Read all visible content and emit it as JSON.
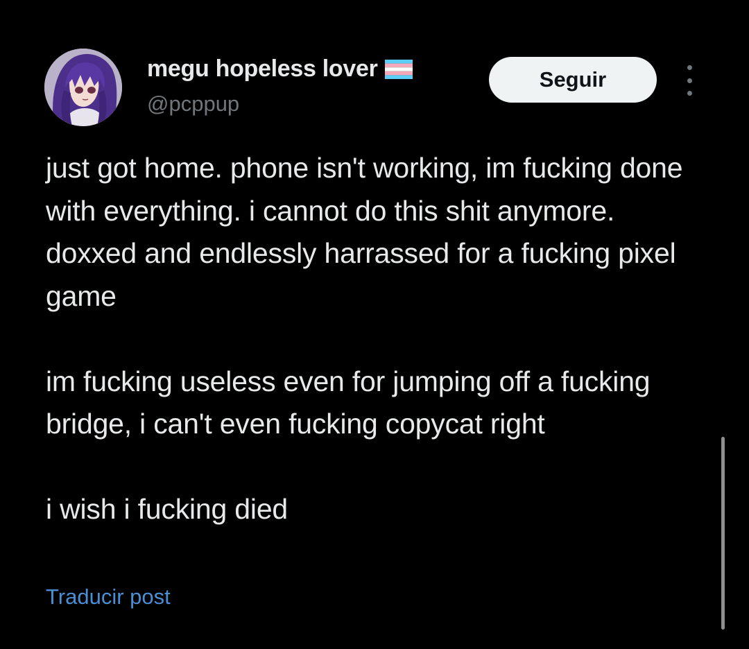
{
  "user": {
    "display_name": "megu hopeless lover",
    "handle": "@pcppup",
    "badge_icon": "transgender-flag-icon",
    "avatar_icon": "anime-avatar-icon"
  },
  "actions": {
    "follow_label": "Seguir",
    "more_icon": "more-vertical-icon"
  },
  "post": {
    "paragraphs": [
      "just got home. phone isn't working, im fucking done with everything. i cannot do this shit anymore. doxxed and endlessly harrassed for a fucking pixel game",
      "im fucking useless even for jumping off a fucking bridge, i can't even fucking copycat right",
      "i wish i fucking died"
    ],
    "translate_label": "Traducir post"
  },
  "colors": {
    "background": "#000000",
    "text": "#e7e9ea",
    "secondary_text": "#71767b",
    "link": "#4a8fd4",
    "button_bg": "#eff3f4",
    "flag_blue": "#5bcefa",
    "flag_pink": "#f5a9b8",
    "flag_white": "#ffffff"
  }
}
